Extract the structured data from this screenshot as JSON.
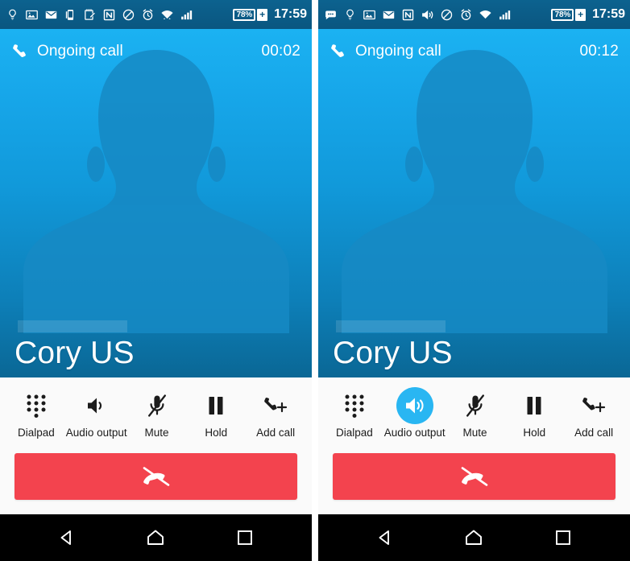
{
  "panels": [
    {
      "id": "left",
      "status_bar": {
        "icons": [
          "lightbulb-icon",
          "image-icon",
          "envelope-icon",
          "device-icon",
          "note-edit-icon",
          "nfc-icon",
          "do-not-disturb-icon",
          "alarm-icon",
          "wifi-icon",
          "signal-icon"
        ],
        "battery_percent": "78%",
        "battery_charging": "+",
        "time": "17:59"
      },
      "call": {
        "status_label": "Ongoing call",
        "timer": "00:02",
        "contact_name": "Cory US"
      },
      "actions": [
        {
          "id": "dialpad",
          "label": "Dialpad",
          "icon": "dialpad-icon",
          "active": false
        },
        {
          "id": "audio-output",
          "label": "Audio output",
          "icon": "speaker-icon",
          "active": false
        },
        {
          "id": "mute",
          "label": "Mute",
          "icon": "mic-off-icon",
          "active": false
        },
        {
          "id": "hold",
          "label": "Hold",
          "icon": "pause-icon",
          "active": false
        },
        {
          "id": "add-call",
          "label": "Add call",
          "icon": "add-call-icon",
          "active": false
        }
      ],
      "end_call": {
        "icon": "call-end-icon",
        "label": "End call"
      },
      "nav_bar": [
        {
          "id": "back",
          "icon": "back-triangle-icon"
        },
        {
          "id": "home",
          "icon": "home-icon"
        },
        {
          "id": "recents",
          "icon": "recents-square-icon"
        }
      ]
    },
    {
      "id": "right",
      "status_bar": {
        "icons": [
          "message-icon",
          "lightbulb-icon",
          "image-icon",
          "envelope-icon",
          "nfc-icon",
          "volume-icon",
          "do-not-disturb-icon",
          "alarm-icon",
          "wifi-icon",
          "signal-icon"
        ],
        "battery_percent": "78%",
        "battery_charging": "+",
        "time": "17:59"
      },
      "call": {
        "status_label": "Ongoing call",
        "timer": "00:12",
        "contact_name": "Cory US"
      },
      "actions": [
        {
          "id": "dialpad",
          "label": "Dialpad",
          "icon": "dialpad-icon",
          "active": false
        },
        {
          "id": "audio-output",
          "label": "Audio output",
          "icon": "speaker-icon",
          "active": true
        },
        {
          "id": "mute",
          "label": "Mute",
          "icon": "mic-off-icon",
          "active": false
        },
        {
          "id": "hold",
          "label": "Hold",
          "icon": "pause-icon",
          "active": false
        },
        {
          "id": "add-call",
          "label": "Add call",
          "icon": "add-call-icon",
          "active": false
        }
      ],
      "end_call": {
        "icon": "call-end-icon",
        "label": "End call"
      },
      "nav_bar": [
        {
          "id": "back",
          "icon": "back-triangle-icon"
        },
        {
          "id": "home",
          "icon": "home-icon"
        },
        {
          "id": "recents",
          "icon": "recents-square-icon"
        }
      ]
    }
  ],
  "colors": {
    "status_bar_bg": "#0a5680",
    "call_bg_top": "#1bb2f2",
    "call_bg_bottom": "#0a6795",
    "accent_active": "#29b6f2",
    "end_call_red": "#f3434e",
    "action_bar_bg": "#fafafa",
    "nav_bar_bg": "#000000"
  }
}
